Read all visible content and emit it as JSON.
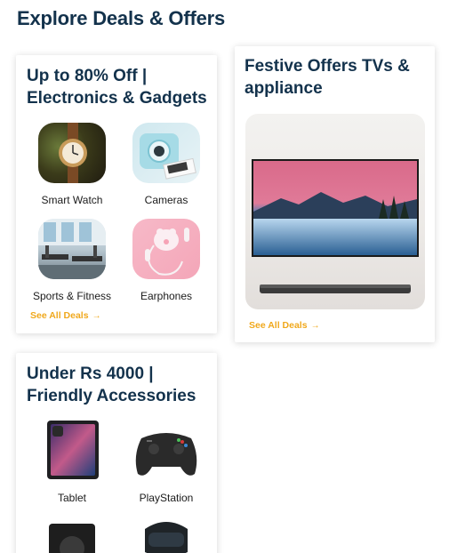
{
  "page": {
    "title": "Explore Deals & Offers"
  },
  "cards": [
    {
      "title_line1": "Up to 80% Off |",
      "title_line2": "Electronics & Gadgets",
      "items": [
        {
          "label": "Smart Watch",
          "icon": "smart-watch-image"
        },
        {
          "label": "Cameras",
          "icon": "camera-image"
        },
        {
          "label": "Sports & Fitness",
          "icon": "gym-equipment-image"
        },
        {
          "label": "Earphones",
          "icon": "earphones-image"
        }
      ],
      "see_all": "See All Deals"
    },
    {
      "title_line1": "Festive Offers TVs &",
      "title_line2": "appliance",
      "image": "television-image",
      "see_all": "See All Deals"
    },
    {
      "title_line1": "Under Rs 4000 |",
      "title_line2": "Friendly Accessories",
      "items": [
        {
          "label": "Tablet",
          "icon": "tablet-image"
        },
        {
          "label": "PlayStation",
          "icon": "gamepad-image"
        }
      ]
    }
  ],
  "colors": {
    "heading": "#13324c",
    "accent": "#f0a81c"
  },
  "icons": {
    "arrow": "→"
  }
}
